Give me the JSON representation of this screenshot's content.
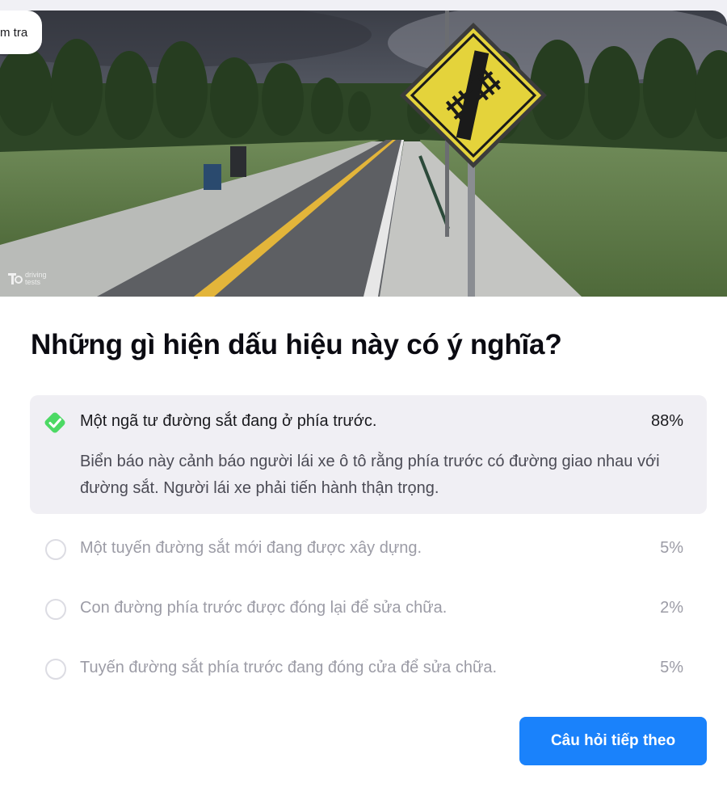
{
  "badge": {
    "label": "m tra"
  },
  "hero": {
    "watermark": "driving tests",
    "sign_icon": "railroad-crossing-sign"
  },
  "question": {
    "title": "Những gì hiện dấu hiệu này có ý nghĩa?"
  },
  "options": [
    {
      "text": "Một ngã tư đường sắt đang ở phía trước.",
      "percent": "88%",
      "state": "correct",
      "explanation": "Biển báo này cảnh báo người lái xe ô tô rằng phía trước có đường giao nhau với đường sắt. Người lái xe phải tiến hành thận trọng."
    },
    {
      "text": "Một tuyến đường sắt mới đang được xây dựng.",
      "percent": "5%"
    },
    {
      "text": "Con đường phía trước được đóng lại để sửa chữa.",
      "percent": "2%"
    },
    {
      "text": "Tuyến đường sắt phía trước đang đóng cửa để sửa chữa.",
      "percent": "5%"
    }
  ],
  "actions": {
    "next_label": "Câu hỏi tiếp theo"
  },
  "colors": {
    "accent": "#1a82fb",
    "correct": "#4cd964",
    "selected_bg": "#f0eff4"
  }
}
